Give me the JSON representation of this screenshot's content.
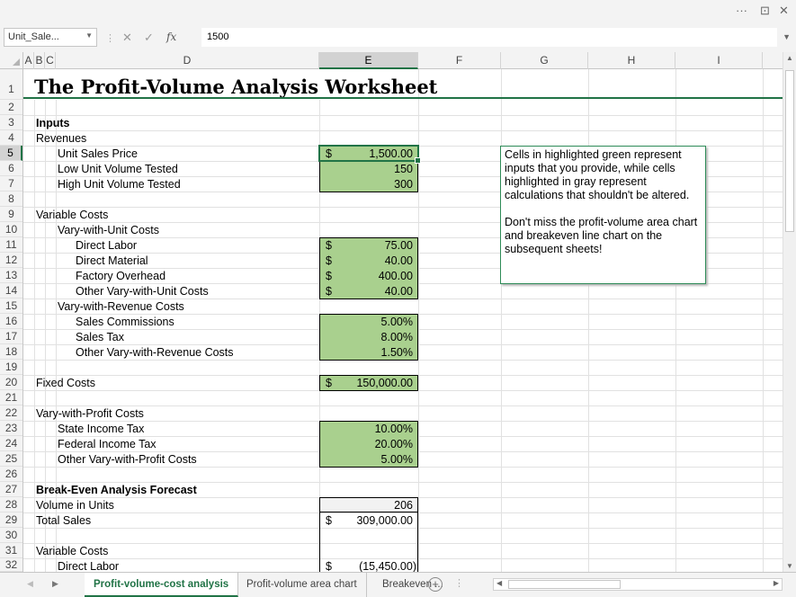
{
  "window": {
    "more_icon": "···",
    "restore_icon": "⊡",
    "close_icon": "✕"
  },
  "formula_bar": {
    "name_box": "Unit_Sale...",
    "cancel_icon": "✕",
    "enter_icon": "✓",
    "fx_icon": "fx",
    "value": "1500",
    "separator": "⋮"
  },
  "columns": [
    "A",
    "B",
    "C",
    "D",
    "E",
    "F",
    "G",
    "H",
    "I"
  ],
  "selected_column": "E",
  "rows": [
    "1",
    "2",
    "3",
    "4",
    "5",
    "6",
    "7",
    "8",
    "9",
    "10",
    "11",
    "12",
    "13",
    "14",
    "15",
    "16",
    "17",
    "18",
    "19",
    "20",
    "21",
    "22",
    "23",
    "24",
    "25",
    "26",
    "27",
    "28",
    "29",
    "30",
    "31",
    "32"
  ],
  "selected_row": "5",
  "sheet": {
    "title": "The Profit-Volume Analysis Worksheet",
    "inputs": "Inputs",
    "revenues": "Revenues",
    "unit_sales_price": "Unit Sales Price",
    "low_unit_volume": "Low Unit Volume Tested",
    "high_unit_volume": "High Unit Volume Tested",
    "variable_costs": "Variable Costs",
    "vary_with_unit": "Vary-with-Unit Costs",
    "direct_labor": "Direct Labor",
    "direct_material": "Direct Material",
    "factory_overhead": "Factory Overhead",
    "other_unit": "Other Vary-with-Unit Costs",
    "vary_with_revenue": "Vary-with-Revenue Costs",
    "sales_commissions": "Sales Commissions",
    "sales_tax": "Sales Tax",
    "other_revenue": "Other Vary-with-Revenue Costs",
    "fixed_costs": "Fixed Costs",
    "vary_with_profit": "Vary-with-Profit Costs",
    "state_income_tax": "State Income Tax",
    "federal_income_tax": "Federal Income Tax",
    "other_profit": "Other Vary-with-Profit Costs",
    "breakeven_forecast": "Break-Even Analysis Forecast",
    "volume_in_units": "Volume in Units",
    "total_sales": "Total Sales",
    "variable_costs_2": "Variable Costs",
    "direct_labor_2": "Direct Labor"
  },
  "values": {
    "dollar": "$",
    "unit_sales_price": "1,500.00",
    "low_unit_volume": "150",
    "high_unit_volume": "300",
    "direct_labor": "75.00",
    "direct_material": "40.00",
    "factory_overhead": "400.00",
    "other_unit": "40.00",
    "sales_commissions": "5.00%",
    "sales_tax": "8.00%",
    "other_revenue": "1.50%",
    "fixed_costs": "150,000.00",
    "state_income_tax": "10.00%",
    "federal_income_tax": "20.00%",
    "other_profit": "5.00%",
    "volume_in_units": "206",
    "total_sales": "309,000.00",
    "direct_labor_2": "(15,450.00)"
  },
  "note": {
    "para1": "Cells in highlighted green represent inputs that you provide, while cells highlighted in gray represent calculations that shouldn't be altered.",
    "para2": "Don't miss the profit-volume area chart and breakeven line chart on the subsequent sheets!"
  },
  "tabs": {
    "active": "Profit-volume-cost analysis",
    "second": "Profit-volume area chart",
    "third": "Breakeven ...",
    "add_icon": "+",
    "prev_icon": "◀",
    "next_icon": "▶"
  },
  "colors": {
    "accent": "#217346",
    "input_fill": "#a9d08e"
  }
}
